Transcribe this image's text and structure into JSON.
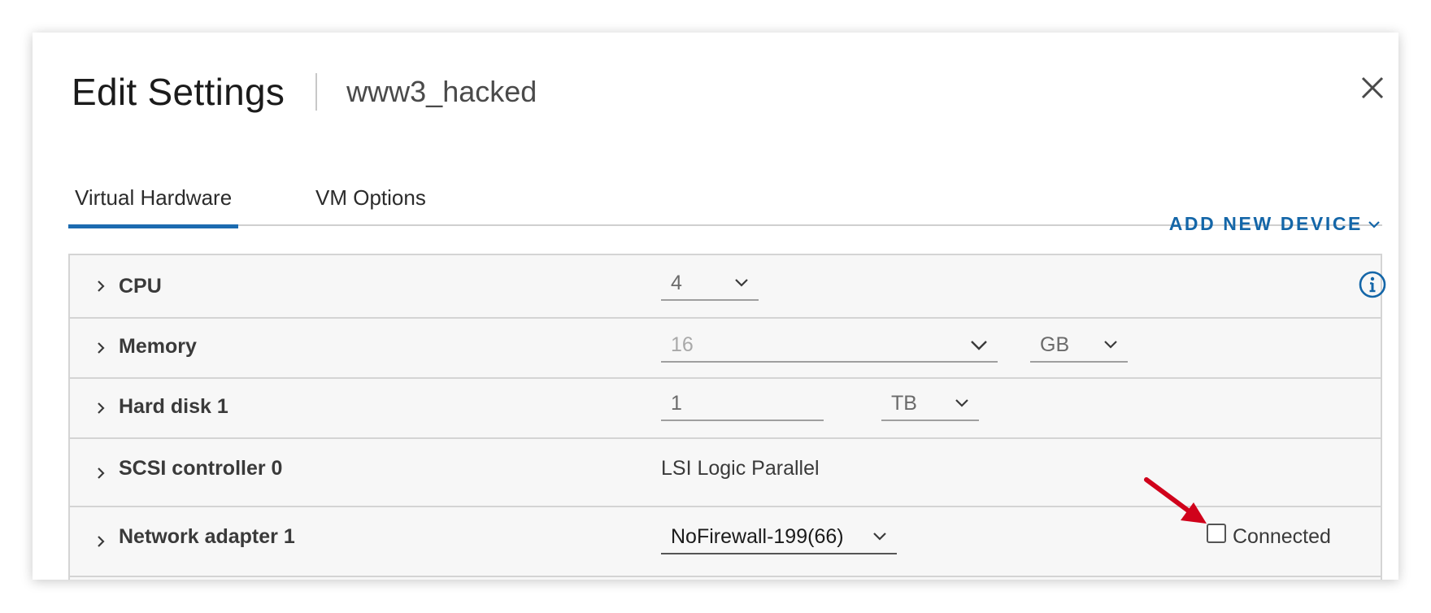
{
  "dialog": {
    "title": "Edit Settings",
    "vm_name": "www3_hacked"
  },
  "tabs": [
    {
      "label": "Virtual Hardware",
      "active": true
    },
    {
      "label": "VM Options",
      "active": false
    }
  ],
  "add_device": {
    "label": "ADD NEW DEVICE"
  },
  "devices": {
    "cpu": {
      "label": "CPU",
      "value": "4"
    },
    "memory": {
      "label": "Memory",
      "value": "16",
      "unit": "GB"
    },
    "hard_disk": {
      "label": "Hard disk 1",
      "value": "1",
      "unit": "TB"
    },
    "scsi": {
      "label": "SCSI controller 0",
      "value": "LSI Logic Parallel"
    },
    "network": {
      "label": "Network adapter 1",
      "value": "NoFirewall-199(66)",
      "connected_label": "Connected",
      "connected": false
    }
  },
  "colors": {
    "accent": "#1c6bb0",
    "annotation_arrow": "#d0021b"
  }
}
